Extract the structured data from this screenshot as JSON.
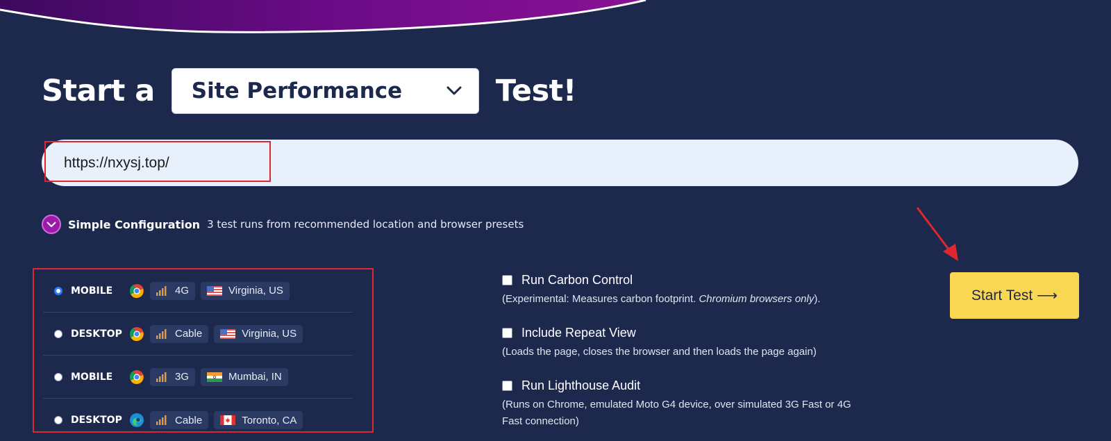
{
  "headline": {
    "prefix": "Start a",
    "suffix": "Test!"
  },
  "test_type": {
    "selected": "Site Performance",
    "icon": "chevron-down-icon"
  },
  "url_input": {
    "value": "https://nxysj.top/"
  },
  "config": {
    "title": "Simple Configuration",
    "description": "3 test runs from recommended location and browser presets",
    "toggle_icon": "chevron-down-icon",
    "accent": "#9c1aa8"
  },
  "presets": [
    {
      "device": "MOBILE",
      "browser": "chrome-icon",
      "connection": "4G",
      "location": "Virginia, US",
      "flag": "us-flag-icon",
      "selected": true
    },
    {
      "device": "DESKTOP",
      "browser": "chrome-icon",
      "connection": "Cable",
      "location": "Virginia, US",
      "flag": "us-flag-icon",
      "selected": false
    },
    {
      "device": "MOBILE",
      "browser": "chrome-icon",
      "connection": "3G",
      "location": "Mumbai, IN",
      "flag": "in-flag-icon",
      "selected": false
    },
    {
      "device": "DESKTOP",
      "browser": "edge-icon",
      "connection": "Cable",
      "location": "Toronto, CA",
      "flag": "ca-flag-icon",
      "selected": false
    }
  ],
  "options": {
    "carbon": {
      "label": "Run Carbon Control",
      "desc_before": "(Experimental: Measures carbon footprint.",
      "desc_em": "Chromium browsers only",
      "desc_after": ")."
    },
    "repeat": {
      "label": "Include Repeat View",
      "desc": "(Loads the page, closes the browser and then loads the page again)"
    },
    "lighthouse": {
      "label": "Run Lighthouse Audit",
      "desc_line1": "(Runs on Chrome, emulated Moto G4 device, over simulated 3G Fast or 4G",
      "desc_line2": "Fast connection)"
    }
  },
  "start_button": {
    "label": "Start Test ⟶"
  },
  "colors": {
    "background": "#1c294d",
    "button": "#f9d752",
    "annotation": "#e0262f"
  }
}
